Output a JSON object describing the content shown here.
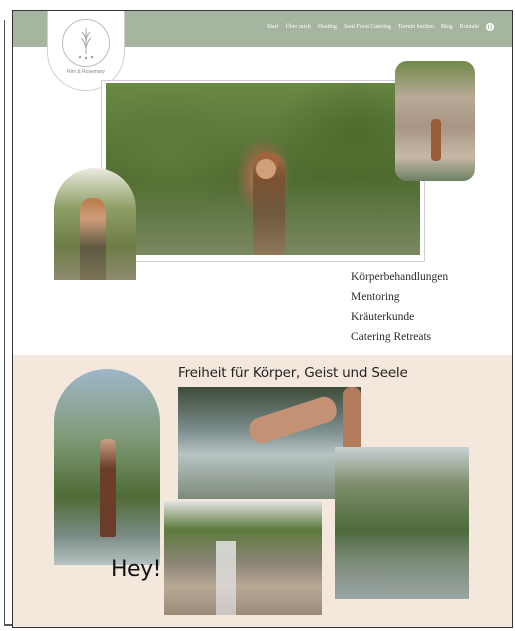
{
  "brand": {
    "logo_text": "Rim & Rosemary"
  },
  "nav": {
    "items": [
      "Start",
      "Über mich",
      "Healing",
      "Soul Food Catering",
      "Termin buchen",
      "Blog",
      "Kontakt"
    ]
  },
  "services": [
    "Körperbehandlungen",
    "Mentoring",
    "Kräuterkunde",
    "Catering Retreats"
  ],
  "section2": {
    "headline": "Freiheit für Körper, Geist und Seele",
    "greeting": "Hey!"
  },
  "colors": {
    "topbar": "#a5b59f",
    "beige": "#f4e8dd"
  },
  "icons": {
    "language": "globe-icon",
    "logo": "lavender-logo-icon"
  }
}
